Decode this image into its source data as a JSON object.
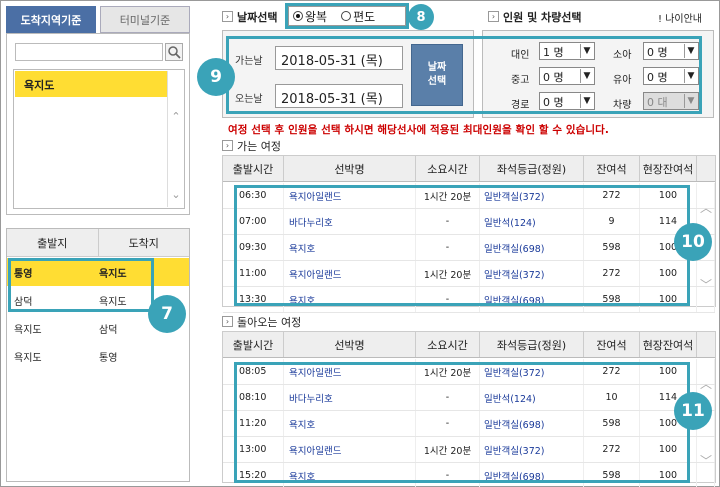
{
  "left_panel": {
    "tabs": [
      "도착지역기준",
      "터미널기준"
    ],
    "search": {
      "value": ""
    },
    "list_items": [
      "욕지도"
    ],
    "od_headers": [
      "출발지",
      "도착지"
    ],
    "od_rows": [
      {
        "from": "통영",
        "to": "욕지도",
        "selected": true
      },
      {
        "from": "삼덕",
        "to": "욕지도",
        "selected": false
      },
      {
        "from": "욕지도",
        "to": "삼덕",
        "selected": false
      },
      {
        "from": "욕지도",
        "to": "통영",
        "selected": false
      }
    ]
  },
  "date_section": {
    "title": "날짜선택",
    "trip_types": [
      {
        "label": "왕복",
        "selected": true
      },
      {
        "label": "편도",
        "selected": false
      }
    ],
    "depart_label": "가는날",
    "depart_value": "2018-05-31 (목)",
    "return_label": "오는날",
    "return_value": "2018-05-31 (목)",
    "select_button": "날짜\n선택"
  },
  "pax_section": {
    "title": "인원 및 차량선택",
    "age_guide": "나이안내",
    "fields": [
      {
        "label": "대인",
        "value": "1 명"
      },
      {
        "label": "소아",
        "value": "0 명"
      },
      {
        "label": "중고",
        "value": "0 명"
      },
      {
        "label": "유아",
        "value": "0 명"
      },
      {
        "label": "경로",
        "value": "0 명"
      },
      {
        "label": "차량",
        "value": "0 대"
      }
    ]
  },
  "notice": "여정 선택 후 인원을 선택 하시면 해당선사에 적용된 최대인원을 확인 할 수 있습니다.",
  "outbound": {
    "title": "가는 여정",
    "headers": [
      "출발시간",
      "선박명",
      "소요시간",
      "좌석등급(정원)",
      "잔여석",
      "현장잔여석"
    ],
    "rows": [
      [
        "06:30",
        "욕지아일랜드",
        "1시간 20분",
        "일반객실(372)",
        "272",
        "100"
      ],
      [
        "07:00",
        "바다누리호",
        "-",
        "일반석(124)",
        "9",
        "114"
      ],
      [
        "09:30",
        "욕지호",
        "-",
        "일반객실(698)",
        "598",
        "100"
      ],
      [
        "11:00",
        "욕지아일랜드",
        "1시간 20분",
        "일반객실(372)",
        "272",
        "100"
      ],
      [
        "13:30",
        "욕지호",
        "-",
        "일반객실(698)",
        "598",
        "100"
      ]
    ]
  },
  "inbound": {
    "title": "돌아오는 여정",
    "headers": [
      "출발시간",
      "선박명",
      "소요시간",
      "좌석등급(정원)",
      "잔여석",
      "현장잔여석"
    ],
    "rows": [
      [
        "08:05",
        "욕지아일랜드",
        "1시간 20분",
        "일반객실(372)",
        "272",
        "100"
      ],
      [
        "08:10",
        "바다누리호",
        "-",
        "일반석(124)",
        "10",
        "114"
      ],
      [
        "11:20",
        "욕지호",
        "-",
        "일반객실(698)",
        "598",
        "100"
      ],
      [
        "13:00",
        "욕지아일랜드",
        "1시간 20분",
        "일반객실(372)",
        "272",
        "100"
      ],
      [
        "15:20",
        "욕지호",
        "-",
        "일반객실(698)",
        "598",
        "100"
      ]
    ]
  },
  "callouts": [
    "7",
    "8",
    "9",
    "10",
    "11"
  ],
  "colors": {
    "highlight": "#3aa3b8",
    "selected_row": "#ffdd33",
    "active_tab": "#4b6fa5",
    "notice": "#cc0000"
  }
}
